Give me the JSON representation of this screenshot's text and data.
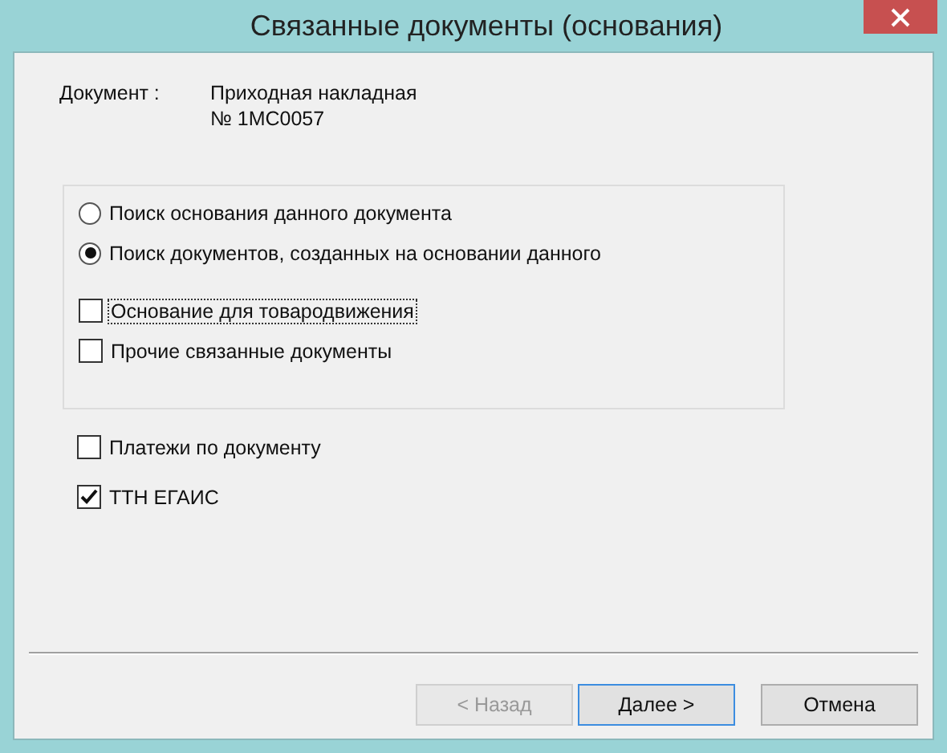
{
  "window": {
    "title": "Связанные документы (основания)"
  },
  "document": {
    "label": "Документ :",
    "lines": [
      "Приходная накладная",
      "№ 1МС0057"
    ]
  },
  "search_modes": [
    {
      "label": "Поиск основания данного документа",
      "selected": false
    },
    {
      "label": "Поиск документов, созданных на основании данного",
      "selected": true
    }
  ],
  "group_options": [
    {
      "label": "Основание для товародвижения",
      "checked": false,
      "focused": true
    },
    {
      "label": "Прочие связанные документы",
      "checked": false,
      "focused": false
    }
  ],
  "options": [
    {
      "label": "Платежи по документу",
      "checked": false,
      "focused": false
    },
    {
      "label": "ТТН ЕГАИС",
      "checked": true,
      "focused": false
    }
  ],
  "buttons": [
    {
      "label": "< Назад",
      "disabled": true,
      "default": false
    },
    {
      "label": "Далее >",
      "disabled": false,
      "default": true
    },
    {
      "label": "Отмена",
      "disabled": false,
      "default": false
    }
  ]
}
